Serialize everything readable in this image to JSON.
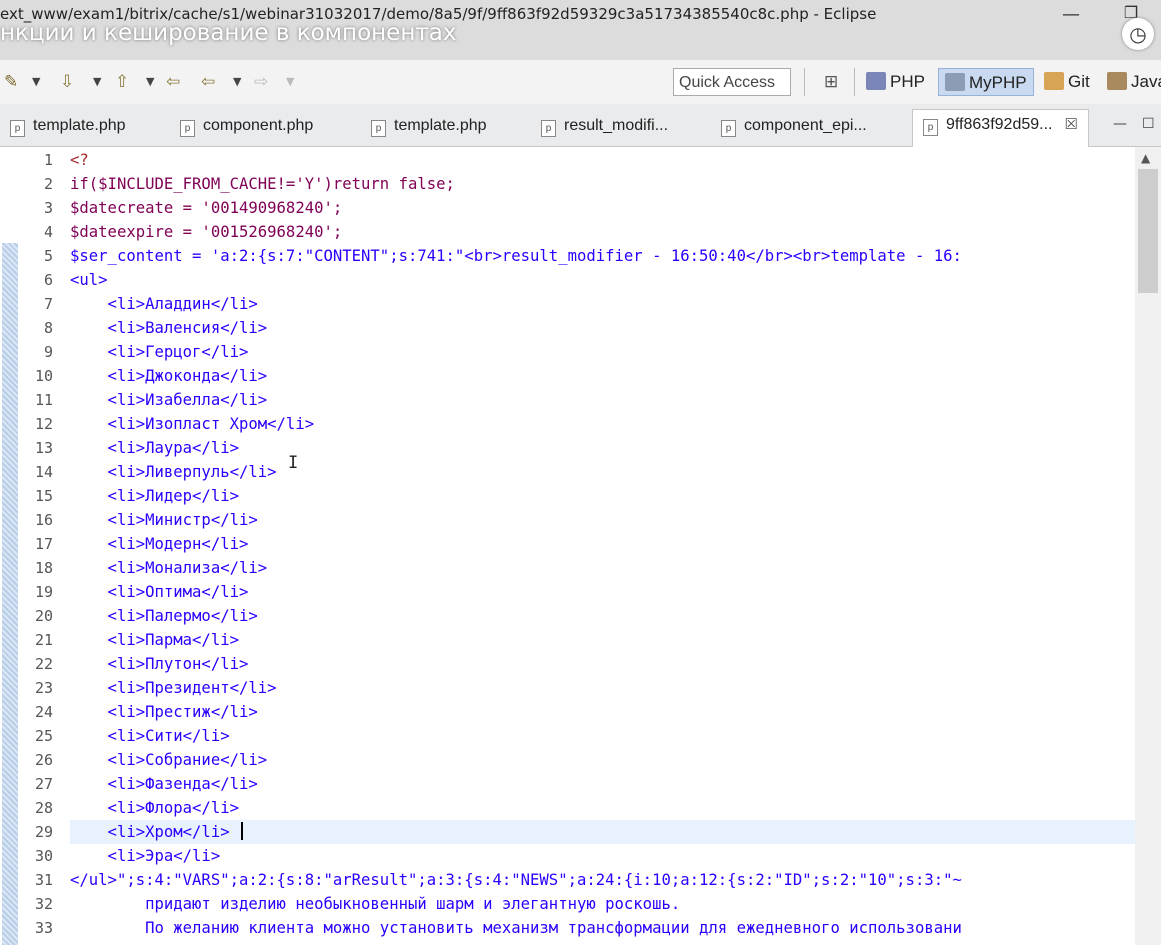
{
  "window": {
    "path_title": "ext_www/exam1/bitrix/cache/s1/webinar31032017/demo/8a5/9f/9ff863f92d59329c3a51734385540c8c.php - Eclipse",
    "overlay_title": "нкции и кеширование в компонентах",
    "min_glyph": "—",
    "max_glyph": "❐",
    "clock_glyph": "◷"
  },
  "toolbar": {
    "quick_access": "Quick Access",
    "perspectives": [
      "PHP",
      "MyPHP",
      "Git",
      "Java"
    ],
    "active_perspective": "MyPHP",
    "icons": [
      "pen-icon",
      "down-arrow-icon",
      "up-arrow-icon",
      "back-folder-icon",
      "back-arrow-icon",
      "forward-arrow-icon"
    ]
  },
  "tabs": [
    {
      "label": "template.php"
    },
    {
      "label": "component.php"
    },
    {
      "label": "template.php"
    },
    {
      "label": "result_modifi..."
    },
    {
      "label": "component_epi..."
    },
    {
      "label": "9ff863f92d59...",
      "active": true
    }
  ],
  "tab_close_glyph": "☒",
  "tab_minmax": [
    "—",
    "☐"
  ],
  "editor": {
    "current_line": 29,
    "lines": [
      {
        "n": "1",
        "t": "<?",
        "c": "tag"
      },
      {
        "n": "2",
        "t": "if($INCLUDE_FROM_CACHE!='Y')return false;",
        "c": "kw"
      },
      {
        "n": "3",
        "t": "$datecreate = '001490968240';",
        "c": "kw"
      },
      {
        "n": "4",
        "t": "$dateexpire = '001526968240';",
        "c": "kw"
      },
      {
        "n": "5",
        "t": "$ser_content = 'a:2:{s:7:\"CONTENT\";s:741:\"<br>result_modifier - 16:50:40</br><br>template - 16:",
        "c": "str"
      },
      {
        "n": "6",
        "t": "<ul>",
        "c": "str"
      },
      {
        "n": "7",
        "t": "    <li>Аладдин</li>",
        "c": "str"
      },
      {
        "n": "8",
        "t": "    <li>Валенсия</li>",
        "c": "str"
      },
      {
        "n": "9",
        "t": "    <li>Герцог</li>",
        "c": "str"
      },
      {
        "n": "10",
        "t": "    <li>Джоконда</li>",
        "c": "str"
      },
      {
        "n": "11",
        "t": "    <li>Изабелла</li>",
        "c": "str"
      },
      {
        "n": "12",
        "t": "    <li>Изопласт Хром</li>",
        "c": "str"
      },
      {
        "n": "13",
        "t": "    <li>Лаура</li>",
        "c": "str"
      },
      {
        "n": "14",
        "t": "    <li>Ливерпуль</li>",
        "c": "str"
      },
      {
        "n": "15",
        "t": "    <li>Лидер</li>",
        "c": "str"
      },
      {
        "n": "16",
        "t": "    <li>Министр</li>",
        "c": "str"
      },
      {
        "n": "17",
        "t": "    <li>Модерн</li>",
        "c": "str"
      },
      {
        "n": "18",
        "t": "    <li>Монализа</li>",
        "c": "str"
      },
      {
        "n": "19",
        "t": "    <li>Оптима</li>",
        "c": "str"
      },
      {
        "n": "20",
        "t": "    <li>Палермо</li>",
        "c": "str"
      },
      {
        "n": "21",
        "t": "    <li>Парма</li>",
        "c": "str"
      },
      {
        "n": "22",
        "t": "    <li>Плутон</li>",
        "c": "str"
      },
      {
        "n": "23",
        "t": "    <li>Президент</li>",
        "c": "str"
      },
      {
        "n": "24",
        "t": "    <li>Престиж</li>",
        "c": "str"
      },
      {
        "n": "25",
        "t": "    <li>Сити</li>",
        "c": "str"
      },
      {
        "n": "26",
        "t": "    <li>Собрание</li>",
        "c": "str"
      },
      {
        "n": "27",
        "t": "    <li>Фазенда</li>",
        "c": "str"
      },
      {
        "n": "28",
        "t": "    <li>Флора</li>",
        "c": "str"
      },
      {
        "n": "29",
        "t": "    <li>Хром</li> ",
        "c": "str"
      },
      {
        "n": "30",
        "t": "    <li>Эра</li>",
        "c": "str"
      },
      {
        "n": "31",
        "t": "</ul>\";s:4:\"VARS\";a:2:{s:8:\"arResult\";a:3:{s:4:\"NEWS\";a:24:{i:10;a:12:{s:2:\"ID\";s:2:\"10\";s:3:\"~",
        "c": "str"
      },
      {
        "n": "32",
        "t": "        придают изделию необыкновенный шарм и элегантную роскошь.",
        "c": "str"
      },
      {
        "n": "33",
        "t": "        По желанию клиента можно установить механизм трансформации для ежедневного использовани",
        "c": "str"
      }
    ]
  },
  "colors": {
    "keyword": "#7f0055",
    "tag": "#a52a2a",
    "string": "#2a00ff",
    "current_line": "#e8f2fe",
    "active_perspective_bg": "#c9daf0"
  }
}
